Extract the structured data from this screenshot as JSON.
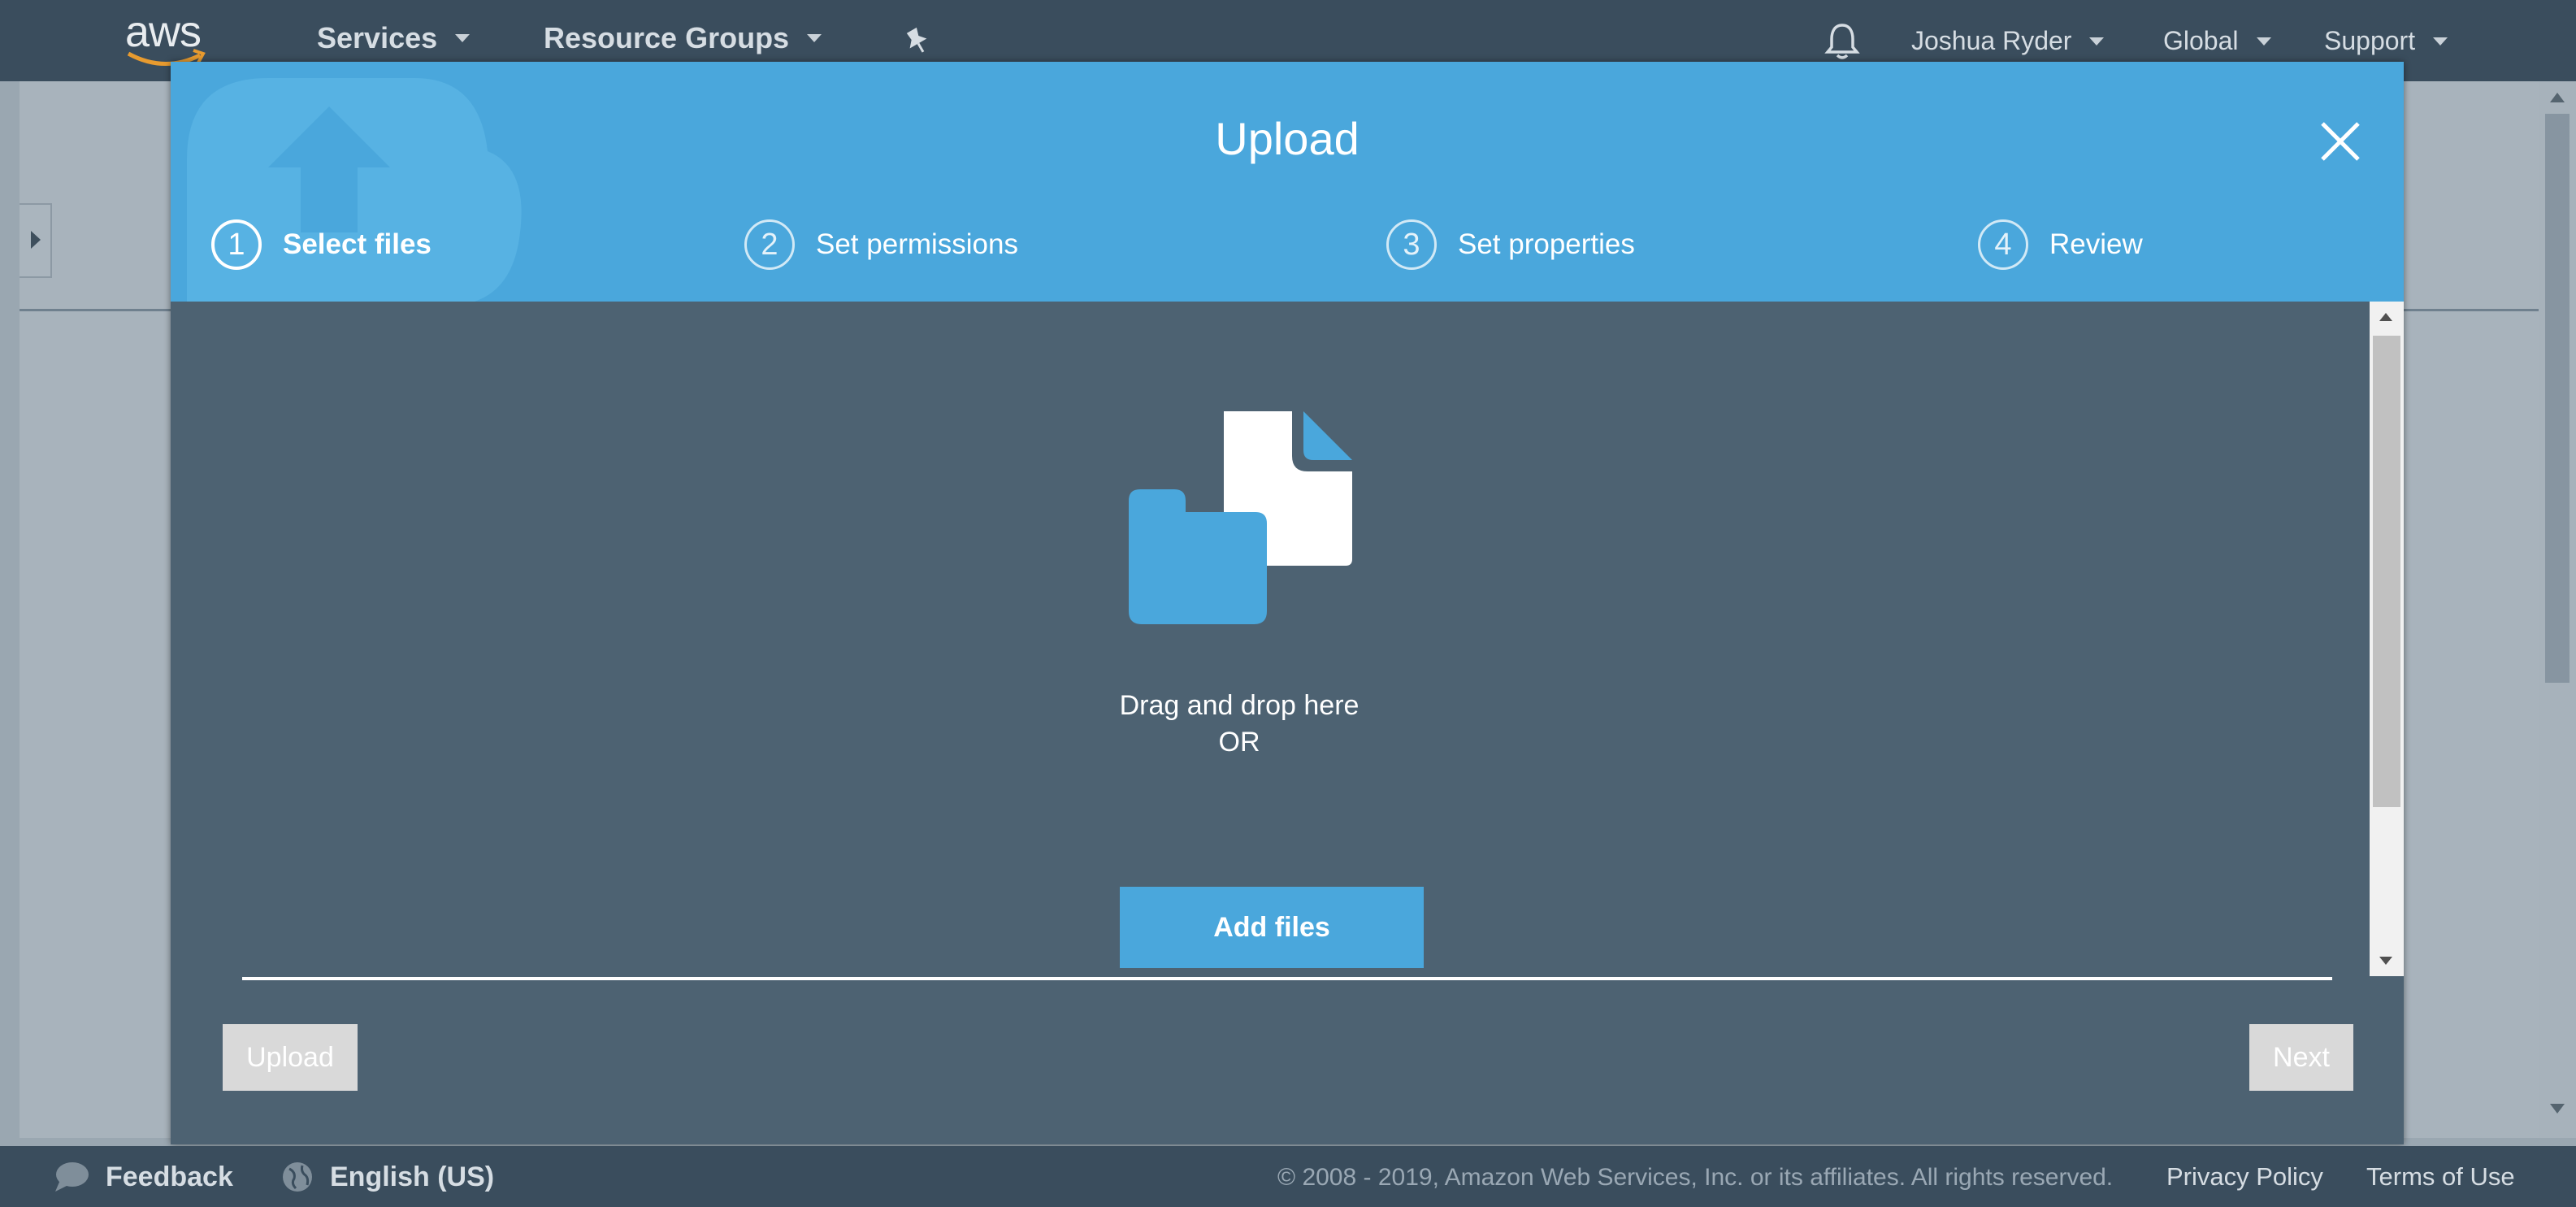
{
  "topnav": {
    "logo_text": "aws",
    "services_label": "Services",
    "resource_groups_label": "Resource Groups",
    "user_label": "Joshua Ryder",
    "region_label": "Global",
    "support_label": "Support"
  },
  "modal": {
    "title": "Upload",
    "steps": [
      {
        "number": "1",
        "label": "Select files",
        "active": true
      },
      {
        "number": "2",
        "label": "Set permissions",
        "active": false
      },
      {
        "number": "3",
        "label": "Set properties",
        "active": false
      },
      {
        "number": "4",
        "label": "Review",
        "active": false
      }
    ],
    "drop_text": "Drag and drop here",
    "or_text": "OR",
    "add_files_label": "Add files",
    "upload_label": "Upload",
    "next_label": "Next"
  },
  "footer": {
    "feedback_label": "Feedback",
    "language_label": "English (US)",
    "copyright": "© 2008 - 2019, Amazon Web Services, Inc. or its affiliates. All rights reserved.",
    "privacy_label": "Privacy Policy",
    "terms_label": "Terms of Use"
  },
  "colors": {
    "accent_blue": "#4aa7dc",
    "nav_bg": "#3a4d5d",
    "modal_body_bg": "#4d6272",
    "disabled_button": "#d9d9d9"
  },
  "icons": [
    "bell-icon",
    "pin-icon",
    "close-icon",
    "speech-bubble-icon",
    "globe-icon",
    "file-icon",
    "folder-icon",
    "cloud-upload-icon"
  ]
}
